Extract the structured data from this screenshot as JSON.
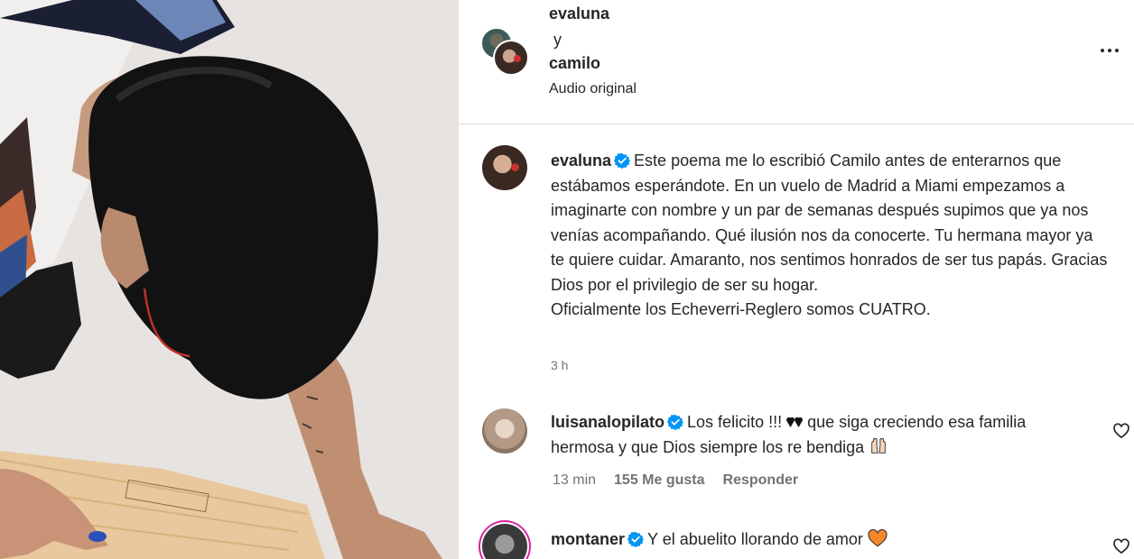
{
  "post": {
    "header": {
      "user1": "evaluna",
      "connector": "y",
      "user2": "camilo",
      "audio": "Audio original",
      "more_icon": "more-horizontal-icon"
    },
    "caption": {
      "username": "evaluna",
      "verified": true,
      "text": "Este poema me lo escribió Camilo antes de enterarnos que estábamos esperándote. En un vuelo de Madrid a Miami empezamos a imaginarte con nombre y un par de semanas después supimos que ya nos venías acompañando. Qué ilusión nos da conocerte. Tu hermana mayor ya te quiere cuidar. Amaranto, nos sentimos honrados de ser tus papás. Gracias Dios por el privilegio de ser su hogar.",
      "text_line2": "Oficialmente los Echeverri-Reglero somos CUATRO.",
      "time": "3 h"
    },
    "comments": [
      {
        "username": "luisanalopilato",
        "verified": true,
        "text_before": "Los felicito !!! ",
        "emoji_1": "black-hearts-emoji",
        "text_after": " que siga creciendo esa familia hermosa y que Dios siempre los re bendiga ",
        "emoji_2": "raising-hands-emoji",
        "time": "13 min",
        "likes": "155 Me gusta",
        "reply": "Responder"
      },
      {
        "username": "montaner",
        "verified": true,
        "text_before": "Y el abuelito llorando de amor ",
        "emoji_1": "orange-heart-emoji"
      }
    ]
  },
  "colors": {
    "verified": "#0095f6",
    "secondary_text": "#737373",
    "orange_heart": "#f4882a"
  }
}
